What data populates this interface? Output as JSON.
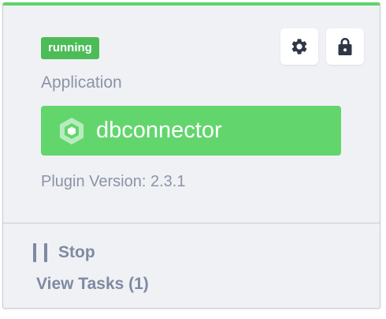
{
  "card": {
    "status_badge": "running",
    "type_label": "Application",
    "app_name": "dbconnector",
    "version_text": "Plugin Version: 2.3.1",
    "icons": {
      "settings": "gear-icon",
      "lock": "lock-icon",
      "app": "hexagon-icon",
      "stop": "pause-icon"
    }
  },
  "actions": {
    "stop_label": "Stop",
    "view_tasks_label": "View Tasks (1)"
  },
  "colors": {
    "accent_green": "#62d66d",
    "badge_green": "#4cbc57",
    "muted_text": "#8a94a6",
    "action_text": "#7e8aa1",
    "card_bg": "#f0f1f5"
  }
}
